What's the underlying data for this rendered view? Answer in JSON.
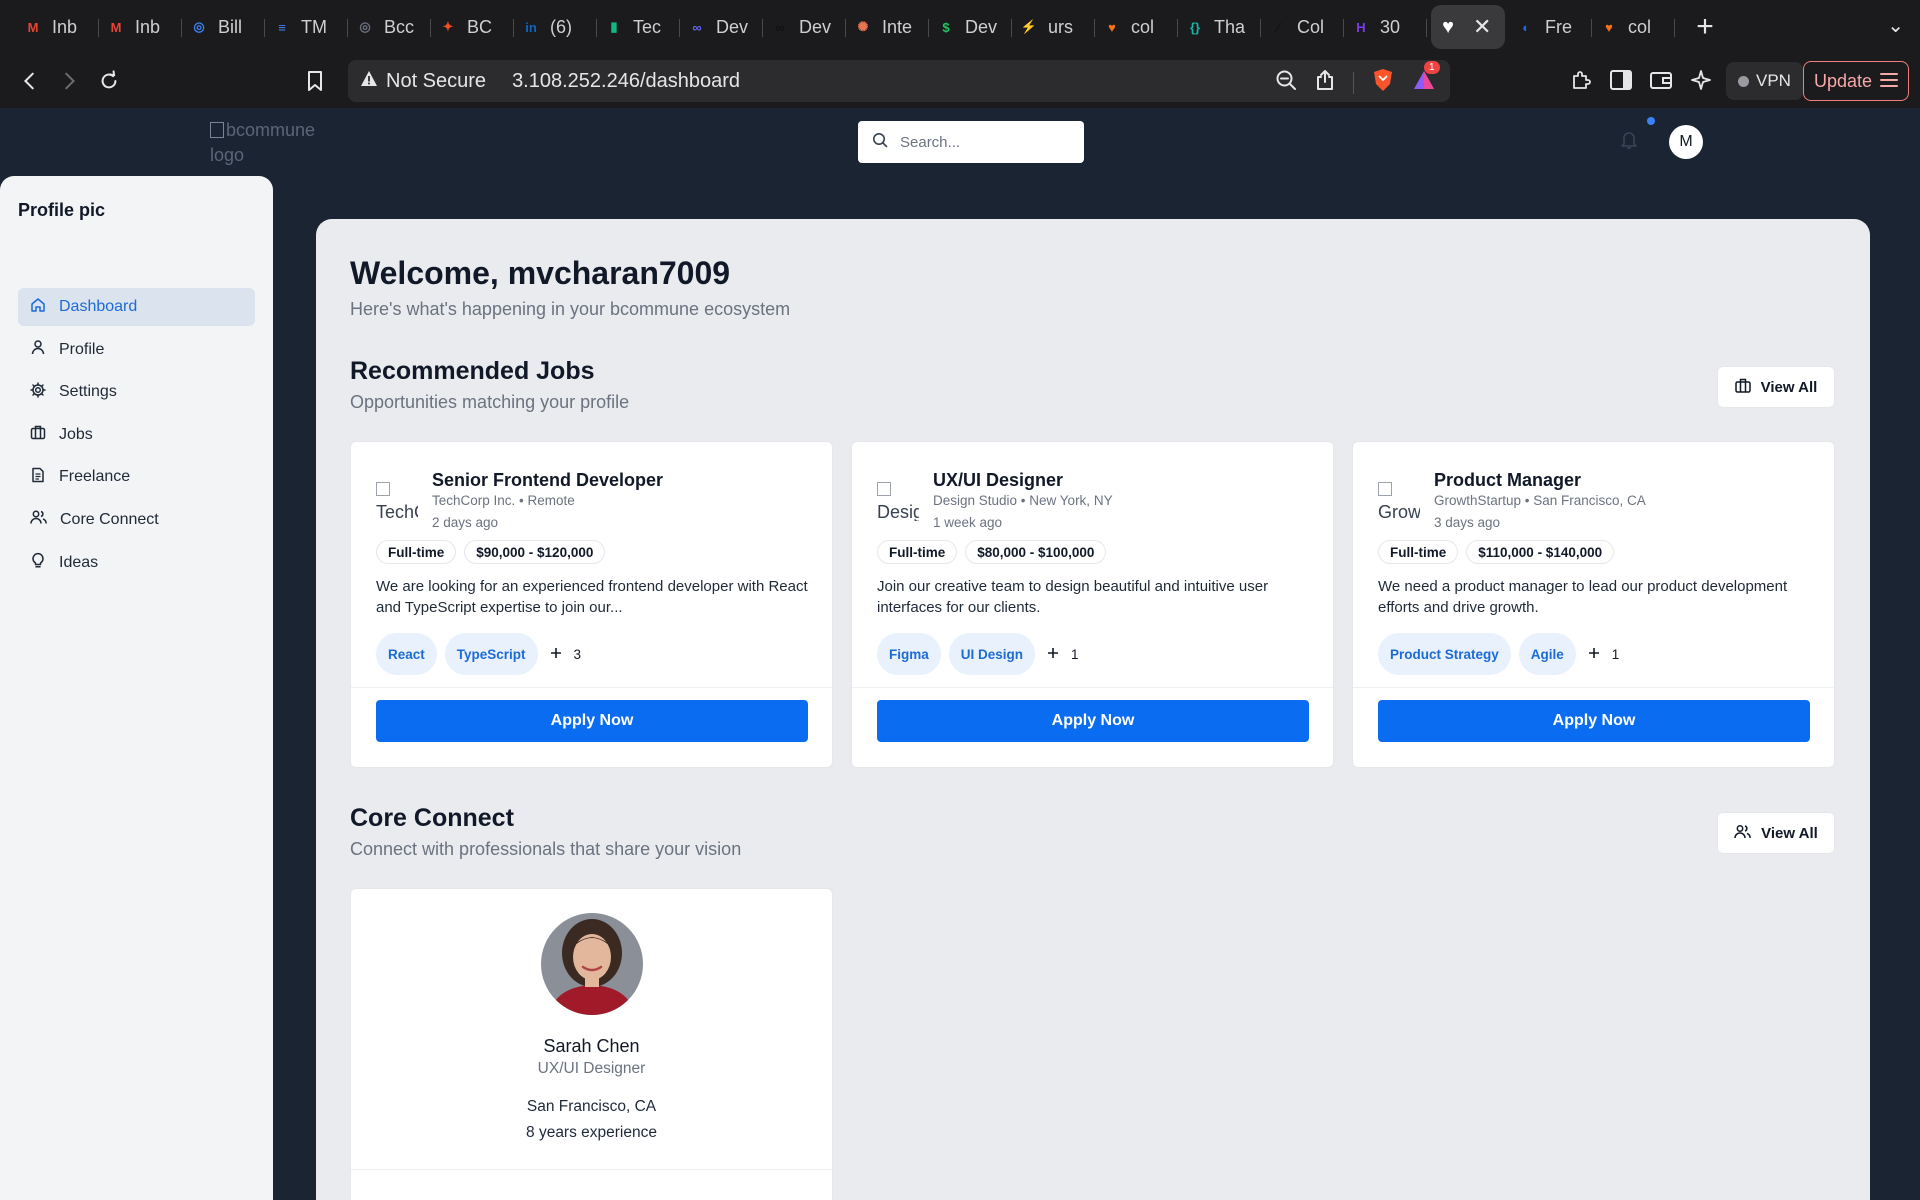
{
  "browser": {
    "tabs": [
      {
        "icon": "gmail-icon",
        "label": "Inb",
        "color": "#ea4335",
        "glyph": "M"
      },
      {
        "icon": "gmail-icon",
        "label": "Inb",
        "color": "#ea4335",
        "glyph": "M"
      },
      {
        "icon": "openai-icon",
        "label": "Bill",
        "color": "#3b82f6",
        "glyph": "◎"
      },
      {
        "icon": "docs-icon",
        "label": "TM",
        "color": "#4285f4",
        "glyph": "≡"
      },
      {
        "icon": "openai-icon",
        "label": "Bcc",
        "color": "#6b7280",
        "glyph": "◎"
      },
      {
        "icon": "figma-icon",
        "label": "BC",
        "color": "#f24e1e",
        "glyph": "✦"
      },
      {
        "icon": "linkedin-icon",
        "label": "(6)",
        "color": "#0a66c2",
        "glyph": "in"
      },
      {
        "icon": "tec-icon",
        "label": "Tec",
        "color": "#10b981",
        "glyph": "▮"
      },
      {
        "icon": "dev-icon",
        "label": "Dev",
        "color": "#6366f1",
        "glyph": "∞"
      },
      {
        "icon": "dev-icon",
        "label": "Dev",
        "color": "#111111",
        "glyph": "∞"
      },
      {
        "icon": "claude-icon",
        "label": "Inte",
        "color": "#e97451",
        "glyph": "✺"
      },
      {
        "icon": "dev-icon",
        "label": "Dev",
        "color": "#22c55e",
        "glyph": "$"
      },
      {
        "icon": "bolt-icon",
        "label": "urs",
        "color": "#22c55e",
        "glyph": "⚡"
      },
      {
        "icon": "heart-icon",
        "label": "col",
        "color": "#f97316",
        "glyph": "♥"
      },
      {
        "icon": "code-icon",
        "label": "Tha",
        "color": "#14b8a6",
        "glyph": "{}"
      },
      {
        "icon": "pen-icon",
        "label": "Col",
        "color": "#111111",
        "glyph": "⁄"
      },
      {
        "icon": "h-icon",
        "label": "30",
        "color": "#7c3aed",
        "glyph": "H"
      }
    ],
    "active_tab": {
      "icon": "heart-icon",
      "close": "✕"
    },
    "tabs_after": [
      {
        "icon": "freelance-icon",
        "label": "Fre",
        "color": "#2563eb",
        "glyph": "◐"
      },
      {
        "icon": "heart-icon",
        "label": "col",
        "color": "#f97316",
        "glyph": "♥"
      }
    ],
    "new_tab": "+",
    "not_secure": "Not Secure",
    "url": "3.108.252.246/dashboard",
    "shield_badge": "1",
    "vpn": "VPN",
    "update": "Update"
  },
  "header": {
    "logo_alt": "bcommune logo",
    "search_placeholder": "Search...",
    "avatar_initial": "M"
  },
  "sidebar": {
    "title": "Profile pic",
    "items": [
      {
        "label": "Dashboard",
        "icon": "home-icon"
      },
      {
        "label": "Profile",
        "icon": "user-icon"
      },
      {
        "label": "Settings",
        "icon": "gear-icon"
      },
      {
        "label": "Jobs",
        "icon": "briefcase-icon"
      },
      {
        "label": "Freelance",
        "icon": "document-icon"
      },
      {
        "label": "Core Connect",
        "icon": "users-icon"
      },
      {
        "label": "Ideas",
        "icon": "lightbulb-icon"
      }
    ]
  },
  "main": {
    "welcome": "Welcome, mvcharan7009",
    "welcome_sub": "Here's what's happening in your bcommune ecosystem",
    "jobs_section": {
      "title": "Recommended Jobs",
      "subtitle": "Opportunities matching your profile",
      "view_all": "View All"
    },
    "jobs": [
      {
        "logo_alt": "TechCorp",
        "title": "Senior Frontend Developer",
        "meta": "TechCorp Inc. • Remote",
        "posted": "2 days ago",
        "type": "Full-time",
        "salary": "$90,000 - $120,000",
        "description": "We are looking for an experienced frontend developer with React and TypeScript expertise to join our...",
        "tags": [
          "React",
          "TypeScript"
        ],
        "more": "3",
        "apply": "Apply Now"
      },
      {
        "logo_alt": "Design",
        "title": "UX/UI Designer",
        "meta": "Design Studio • New York, NY",
        "posted": "1 week ago",
        "type": "Full-time",
        "salary": "$80,000 - $100,000",
        "description": "Join our creative team to design beautiful and intuitive user interfaces for our clients.",
        "tags": [
          "Figma",
          "UI Design"
        ],
        "more": "1",
        "apply": "Apply Now"
      },
      {
        "logo_alt": "Grow",
        "title": "Product Manager",
        "meta": "GrowthStartup • San Francisco, CA",
        "posted": "3 days ago",
        "type": "Full-time",
        "salary": "$110,000 - $140,000",
        "description": "We need a product manager to lead our product development efforts and drive growth.",
        "tags": [
          "Product Strategy",
          "Agile"
        ],
        "more": "1",
        "apply": "Apply Now"
      }
    ],
    "core_section": {
      "title": "Core Connect",
      "subtitle": "Connect with professionals that share your vision",
      "view_all": "View All"
    },
    "people": [
      {
        "name": "Sarah Chen",
        "role": "UX/UI Designer",
        "location": "San Francisco, CA",
        "experience": "8 years experience"
      }
    ]
  }
}
